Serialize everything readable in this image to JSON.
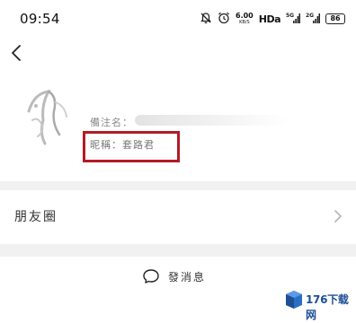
{
  "status_bar": {
    "time": "09:54",
    "net_speed": "6.00",
    "net_speed_unit": "KB/S",
    "hd_label": "HDa",
    "signal_1_label": "5G",
    "signal_2_label": "2G",
    "battery": "86",
    "icons": [
      "bell-off-icon",
      "alarm-icon",
      "signal-5g-icon",
      "signal-2g-icon",
      "battery-icon"
    ]
  },
  "nav": {
    "back_icon": "chevron-left-icon"
  },
  "profile": {
    "name_label": "備注名：",
    "remark_label": "昵稱：套路君"
  },
  "moments": {
    "label": "朋友圈",
    "chevron_icon": "chevron-right-icon"
  },
  "actions": {
    "send_message_label": "發消息",
    "send_message_icon": "message-bubble-icon"
  },
  "watermark": {
    "text": "176下载网"
  },
  "colors": {
    "highlight_box": "#b31b26",
    "background": "#f1f1f1",
    "card": "#ffffff",
    "watermark_blue": "#1d4f96"
  }
}
